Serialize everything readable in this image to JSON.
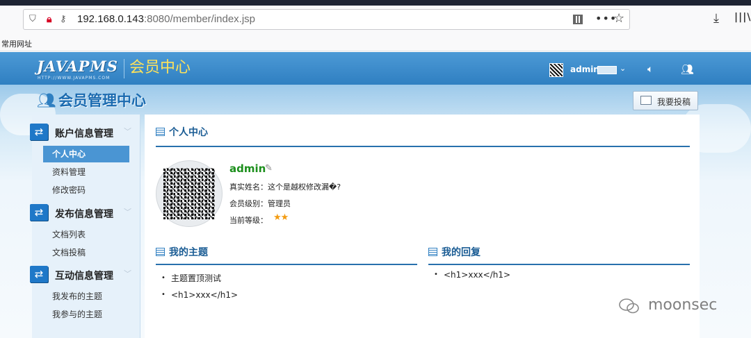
{
  "browser": {
    "url_host": "192.168.0.143",
    "url_rest": ":8080/member/index.jsp",
    "bookmarks_label": "常用网址"
  },
  "header": {
    "logo": "JAVAPMS",
    "logo_sub": "HTTP://WWW.JAVAPMS.COM",
    "center_title": "会员中心",
    "user_name": "admin"
  },
  "page": {
    "heading": "会员管理中心",
    "post_button": "我要投稿"
  },
  "sidebar": {
    "groups": [
      {
        "label": "账户信息管理",
        "items": [
          "个人中心",
          "资料管理",
          "修改密码"
        ]
      },
      {
        "label": "发布信息管理",
        "items": [
          "文档列表",
          "文档投稿"
        ]
      },
      {
        "label": "互动信息管理",
        "items": [
          "我发布的主题",
          "我参与的主题"
        ]
      }
    ],
    "active_item": "个人中心"
  },
  "profile": {
    "section_title": "个人中心",
    "name": "admin",
    "real_name_label": "真实姓名：",
    "real_name_value": "这个是越权修改漏�?",
    "level_label": "会员级别：",
    "level_value": "管理员",
    "rank_label": "当前等级：",
    "rank_stars": 2
  },
  "my_topics": {
    "title": "我的主题",
    "items": [
      "主题置顶测试",
      "<h1>xxx</h1>"
    ]
  },
  "my_replies": {
    "title": "我的回复",
    "items": [
      "<h1>xxx</h1>"
    ]
  },
  "watermark": "moonsec"
}
